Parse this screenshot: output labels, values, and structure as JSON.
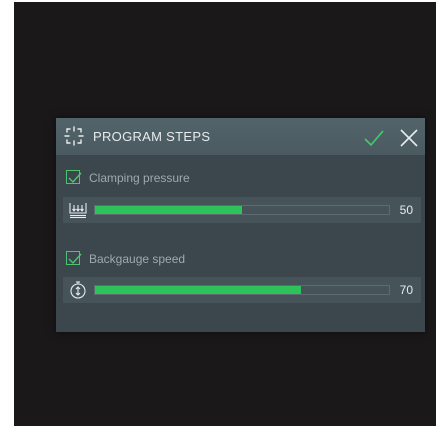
{
  "dialog": {
    "title": "PROGRAM STEPS",
    "header_icon": "focus-corners-icon",
    "confirm_icon": "check-icon",
    "close_icon": "close-icon"
  },
  "steps": [
    {
      "label": "Clamping pressure",
      "checked": true,
      "icon": "clamp-pressure-icon",
      "value": "50",
      "fill_fraction": 0.5
    },
    {
      "label": "Backgauge speed",
      "checked": true,
      "icon": "speed-gauge-icon",
      "value": "70",
      "fill_fraction": 0.7
    }
  ],
  "colors": {
    "accent_green": "#2ec25a",
    "checkbox_green": "#4ec470",
    "panel": "#3c474d",
    "header": "#4e5f65",
    "background": "#1a1818"
  }
}
